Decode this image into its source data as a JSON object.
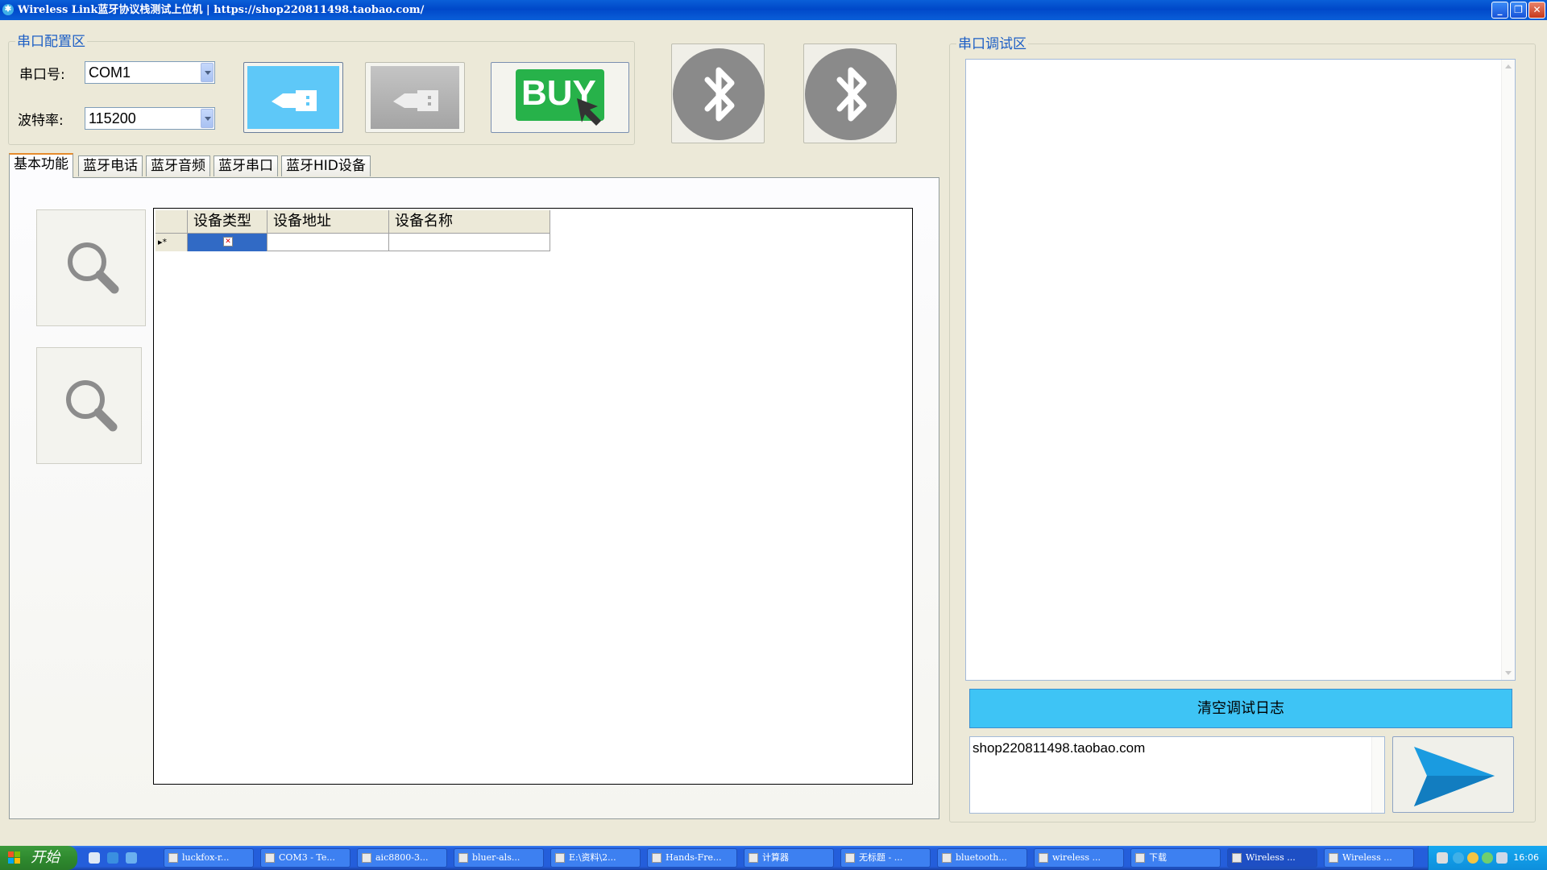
{
  "window": {
    "title": "Wireless Link蓝牙协议栈测试上位机 | https://shop220811498.taobao.com/",
    "minimize": "_",
    "maximize": "❐",
    "close": "✕"
  },
  "serial_config": {
    "group_title": "串口配置区",
    "port_label": "串口号:",
    "port_value": "COM1",
    "baud_label": "波特率:",
    "baud_value": "115200",
    "buy_label": "BUY"
  },
  "tabs": [
    {
      "label": "基本功能",
      "active": true
    },
    {
      "label": "蓝牙电话"
    },
    {
      "label": "蓝牙音频"
    },
    {
      "label": "蓝牙串口"
    },
    {
      "label": "蓝牙HID设备"
    }
  ],
  "device_grid": {
    "columns": [
      "设备类型",
      "设备地址",
      "设备名称"
    ],
    "new_row_marker": "▸*"
  },
  "serial_debug": {
    "group_title": "串口调试区",
    "clear_button": "清空调试日志",
    "send_text": "shop220811498.taobao.com"
  },
  "taskbar": {
    "start_label": "开始",
    "items": [
      "luckfox-r...",
      "COM3 - Te...",
      "aic8800-3...",
      "bluer-als...",
      "E:\\资料\\2...",
      "Hands-Fre...",
      "计算器",
      "无标题 - ...",
      "bluetooth...",
      "wireless ...",
      "下载",
      "Wireless ...",
      "Wireless ..."
    ],
    "clock": "16:06",
    "colors": {
      "accent": "#245edb",
      "start": "#2f8a2f"
    }
  }
}
